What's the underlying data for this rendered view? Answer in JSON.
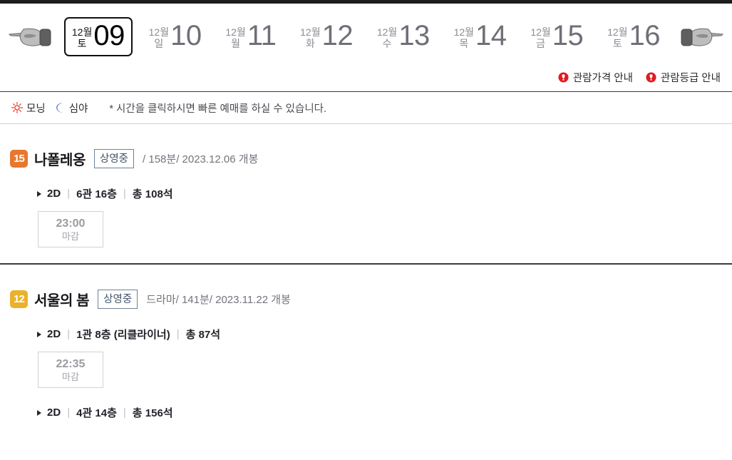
{
  "nav": {
    "prev_icon": "hand-pointer-left-icon",
    "next_icon": "hand-pointer-right-icon",
    "dates": [
      {
        "month": "12월",
        "dow": "토",
        "day": "09",
        "selected": true
      },
      {
        "month": "12월",
        "dow": "일",
        "day": "10",
        "selected": false
      },
      {
        "month": "12월",
        "dow": "월",
        "day": "11",
        "selected": false
      },
      {
        "month": "12월",
        "dow": "화",
        "day": "12",
        "selected": false
      },
      {
        "month": "12월",
        "dow": "수",
        "day": "13",
        "selected": false
      },
      {
        "month": "12월",
        "dow": "목",
        "day": "14",
        "selected": false
      },
      {
        "month": "12월",
        "dow": "금",
        "day": "15",
        "selected": false
      },
      {
        "month": "12월",
        "dow": "토",
        "day": "16",
        "selected": false
      }
    ]
  },
  "info_links": [
    {
      "label": "관람가격 안내",
      "icon": "warning-circle-icon",
      "color": "#e01b22"
    },
    {
      "label": "관람등급 안내",
      "icon": "warning-circle-icon",
      "color": "#e01b22"
    }
  ],
  "legend": {
    "morning": {
      "label": "모닝",
      "icon": "sun-icon",
      "color": "#e8553f"
    },
    "late": {
      "label": "심야",
      "icon": "moon-icon",
      "color": "#3c5fb0"
    },
    "note": "* 시간을 클릭하시면 빠른 예매를 하실 수 있습니다."
  },
  "movies": [
    {
      "rating": "15",
      "rating_color": "#e8782d",
      "title": "나폴레옹",
      "status": "상영중",
      "meta": "/ 158분/ 2023.12.06 개봉",
      "halls": [
        {
          "format": "2D",
          "name": "6관 16층",
          "seats": "총 108석",
          "showtimes": [
            {
              "time": "23:00",
              "state": "마감"
            }
          ]
        }
      ]
    },
    {
      "rating": "12",
      "rating_color": "#eab12c",
      "title": "서울의 봄",
      "status": "상영중",
      "meta": "드라마/ 141분/ 2023.11.22 개봉",
      "halls": [
        {
          "format": "2D",
          "name": "1관 8층 (리클라이너)",
          "seats": "총 87석",
          "showtimes": [
            {
              "time": "22:35",
              "state": "마감"
            }
          ]
        },
        {
          "format": "2D",
          "name": "4관 14층",
          "seats": "총 156석",
          "showtimes": []
        }
      ]
    }
  ]
}
